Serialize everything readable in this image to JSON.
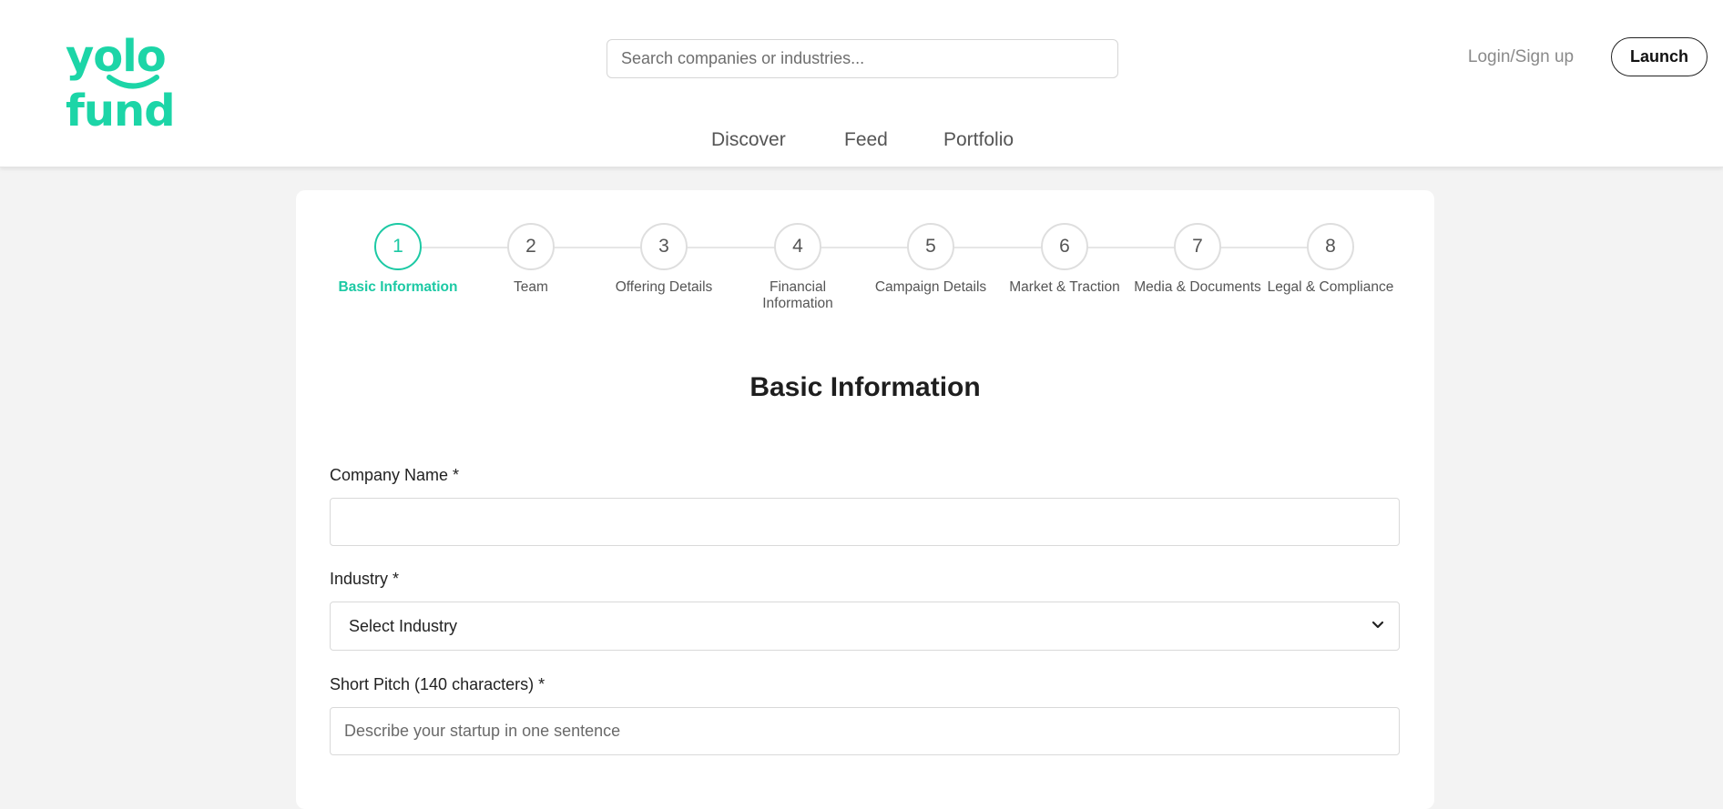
{
  "header": {
    "logo_text": "yolo fund",
    "search_placeholder": "Search companies or industries...",
    "login_label": "Login/Sign up",
    "launch_label": "Launch",
    "nav": [
      "Discover",
      "Feed",
      "Portfolio"
    ]
  },
  "steps": [
    {
      "number": "1",
      "label": "Basic Information"
    },
    {
      "number": "2",
      "label": "Team"
    },
    {
      "number": "3",
      "label": "Offering Details"
    },
    {
      "number": "4",
      "label": "Financial Information"
    },
    {
      "number": "5",
      "label": "Campaign Details"
    },
    {
      "number": "6",
      "label": "Market & Traction"
    },
    {
      "number": "7",
      "label": "Media & Documents"
    },
    {
      "number": "8",
      "label": "Legal & Compliance"
    }
  ],
  "active_step": 1,
  "form": {
    "title": "Basic Information",
    "company_name": {
      "label": "Company Name *",
      "value": ""
    },
    "industry": {
      "label": "Industry *",
      "selected": "Select Industry"
    },
    "short_pitch": {
      "label": "Short Pitch (140 characters) *",
      "placeholder": "Describe your startup in one sentence",
      "value": ""
    }
  },
  "colors": {
    "brand": "#1cd5a7",
    "active_step": "#1cc9a4",
    "background": "#f3f3f3"
  },
  "icons": {
    "select_arrow": "chevron-down-icon"
  }
}
